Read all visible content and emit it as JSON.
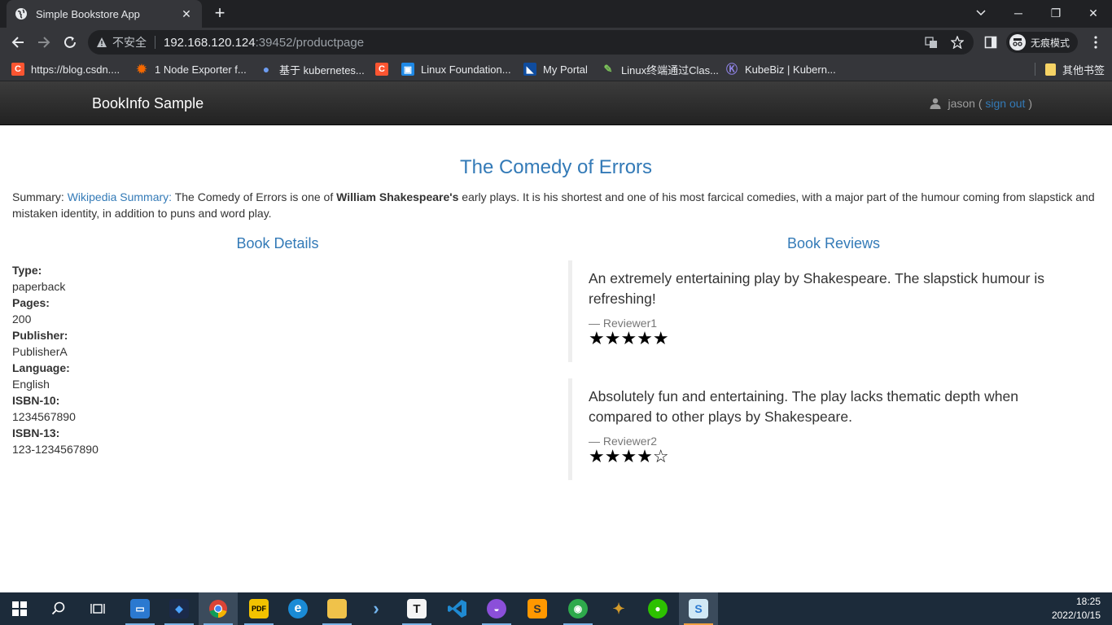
{
  "browser": {
    "tab_title": "Simple Bookstore App",
    "tab_close": "✕",
    "new_tab": "+",
    "window_controls": {
      "minimize": "─",
      "restore": "❐",
      "close": "✕"
    },
    "security_label": "不安全",
    "url_host": "192.168.120.124",
    "url_path": ":39452/productpage",
    "incognito_label": "无痕模式",
    "bookmarks": [
      {
        "label": "https://blog.csdn....",
        "icon": "csdn-icon",
        "color": "#fc5531",
        "glyph": "C"
      },
      {
        "label": "1 Node Exporter f...",
        "icon": "grafana-icon",
        "color": "#f46800",
        "glyph": "✹"
      },
      {
        "label": "基于 kubernetes...",
        "icon": "pin-icon",
        "color": "#3b6fd8",
        "glyph": "●"
      },
      {
        "label": "",
        "icon": "csdn-icon",
        "color": "#fc5531",
        "glyph": "C"
      },
      {
        "label": "Linux Foundation...",
        "icon": "linux-foundation-icon",
        "color": "#1e88e5",
        "glyph": "▣"
      },
      {
        "label": "My Portal",
        "icon": "portal-icon",
        "color": "#0f4c9e",
        "glyph": "◣"
      },
      {
        "label": "Linux终端通过Clas...",
        "icon": "leaf-icon",
        "color": "#4a8f2a",
        "glyph": "✎"
      },
      {
        "label": "KubeBiz | Kubern...",
        "icon": "kubebiz-icon",
        "color": "#6b5bd2",
        "glyph": "K"
      }
    ],
    "other_bookmarks": "其他书签"
  },
  "app": {
    "brand": "BookInfo Sample",
    "user": "jason",
    "sign_out_open": "(",
    "sign_out": "sign out",
    "sign_out_close": ")"
  },
  "product": {
    "title": "The Comedy of Errors",
    "summary_prefix": "Summary:",
    "summary_link": "Wikipedia Summary:",
    "summary_text_1": "The Comedy of Errors is one of",
    "summary_bold": "William Shakespeare's",
    "summary_text_2": "early plays. It is his shortest and one of his most farcical comedies, with a major part of the humour coming from slapstick and mistaken identity, in addition to puns and word play."
  },
  "details": {
    "heading": "Book Details",
    "items": [
      {
        "label": "Type:",
        "value": "paperback"
      },
      {
        "label": "Pages:",
        "value": "200"
      },
      {
        "label": "Publisher:",
        "value": "PublisherA"
      },
      {
        "label": "Language:",
        "value": "English"
      },
      {
        "label": "ISBN-10:",
        "value": "1234567890"
      },
      {
        "label": "ISBN-13:",
        "value": "123-1234567890"
      }
    ]
  },
  "reviews": {
    "heading": "Book Reviews",
    "items": [
      {
        "text": "An extremely entertaining play by Shakespeare. The slapstick humour is refreshing!",
        "reviewer": "— Reviewer1",
        "rating": 5,
        "stars": "★★★★★"
      },
      {
        "text": "Absolutely fun and entertaining. The play lacks thematic depth when compared to other plays by Shakespeare.",
        "reviewer": "— Reviewer2",
        "rating": 4,
        "stars": "★★★★☆"
      }
    ]
  },
  "taskbar": {
    "apps": [
      {
        "name": "start-button",
        "color": "transparent",
        "glyph": ""
      },
      {
        "name": "search-icon",
        "color": "transparent",
        "glyph": ""
      },
      {
        "name": "task-view-icon",
        "color": "transparent",
        "glyph": ""
      },
      {
        "name": "remote-desktop-icon",
        "color": "#2b79d0",
        "glyph": "▭"
      },
      {
        "name": "terminal-cat-icon",
        "color": "#1b2a4a",
        "glyph": "◆"
      },
      {
        "name": "chrome-icon",
        "color": "#db4437",
        "glyph": "●"
      },
      {
        "name": "pdf-reader-icon",
        "color": "#f2c200",
        "glyph": "PDF"
      },
      {
        "name": "edge-icon",
        "color": "#1a8bd6",
        "glyph": "e"
      },
      {
        "name": "file-explorer-icon",
        "color": "#f0c24a",
        "glyph": "▬"
      },
      {
        "name": "powershell-icon",
        "color": "#2f74c0",
        "glyph": "›"
      },
      {
        "name": "typora-icon",
        "color": "#f5f5f5",
        "glyph": "T"
      },
      {
        "name": "vscode-icon",
        "color": "#1f8ad2",
        "glyph": "⟩"
      },
      {
        "name": "app-purple-icon",
        "color": "#8b4fd9",
        "glyph": "◒"
      },
      {
        "name": "sublime-icon",
        "color": "#ff9800",
        "glyph": "S"
      },
      {
        "name": "xshell-icon",
        "color": "#2eaa4c",
        "glyph": "◉"
      },
      {
        "name": "xftp-icon",
        "color": "#d39a2a",
        "glyph": "✦"
      },
      {
        "name": "wechat-icon",
        "color": "#2dc100",
        "glyph": "●"
      },
      {
        "name": "sealos-icon",
        "color": "#d1e8f5",
        "glyph": "S"
      }
    ],
    "time": "18:25",
    "date": "2022/10/15"
  }
}
